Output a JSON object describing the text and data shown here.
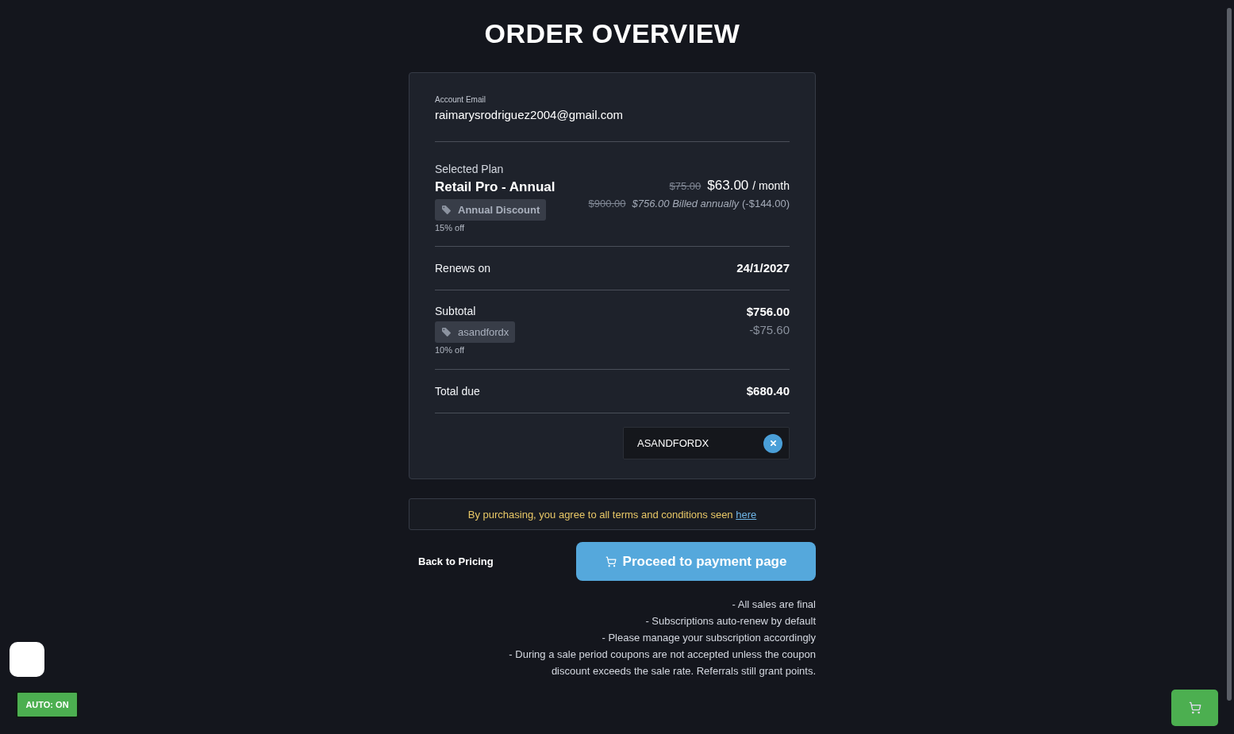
{
  "page_title": "ORDER OVERVIEW",
  "order_card": {
    "account": {
      "label": "Account Email",
      "email": "raimarysrodriguez2004@gmail.com"
    },
    "plan": {
      "label": "Selected Plan",
      "name": "Retail Pro - Annual",
      "discount_tag": "Annual Discount",
      "discount_note": "15% off",
      "original_monthly": "$75.00",
      "monthly_price": "$63.00",
      "period": "/ month",
      "original_annual": "$900.00",
      "annual_billing": "$756.00 Billed annually",
      "annual_savings": "(-$144.00)"
    },
    "renewal": {
      "label": "Renews on",
      "date": "24/1/2027"
    },
    "subtotal": {
      "label": "Subtotal",
      "amount": "$756.00",
      "coupon_tag": "asandfordx",
      "coupon_note": "10% off",
      "coupon_discount": "-$75.60"
    },
    "total": {
      "label": "Total due",
      "amount": "$680.40"
    },
    "coupon_field": {
      "value": "ASANDFORDX"
    }
  },
  "terms": {
    "text": "By purchasing, you agree to all terms and conditions seen",
    "link": "here"
  },
  "actions": {
    "back": "Back to Pricing",
    "proceed": "Proceed to payment page"
  },
  "notes": [
    "- All sales are final",
    "- Subscriptions auto-renew by default",
    "- Please manage your subscription accordingly",
    "- During a sale period coupons are not accepted unless the coupon discount exceeds the sale rate. Referrals still grant points."
  ],
  "auto_toggle": {
    "label": "AUTO: ON",
    "on": true
  }
}
